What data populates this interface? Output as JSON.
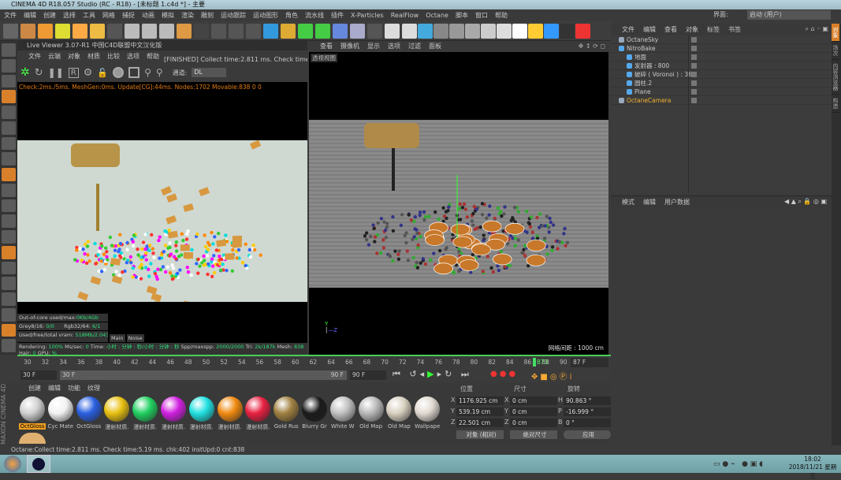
{
  "window": {
    "title": "CINEMA 4D R18.057 Studio (RC - R18) - [未标题 1.c4d *] - 主要"
  },
  "menu": [
    "文件",
    "编辑",
    "创建",
    "选择",
    "工具",
    "网格",
    "捕捉",
    "动画",
    "模拟",
    "渲染",
    "雕刻",
    "运动跟踪",
    "运动图形",
    "角色",
    "流水线",
    "插件",
    "X-Particles",
    "RealFlow",
    "Octane",
    "脚本",
    "窗口",
    "帮助"
  ],
  "layout": {
    "label": "界面:",
    "value": "启动 (用户)"
  },
  "live_viewer": {
    "title": "Live Viewer 3.07-R1 中国C4D联盟中文汉化版",
    "menu": [
      "文件",
      "云端",
      "对象",
      "材质",
      "比较",
      "选项",
      "帮助"
    ],
    "message": "[FINISHED] Collect time:2.811 ms.  Check time:5.19",
    "channel_label": "通道:",
    "channel_value": "DL",
    "check_line": "Check:2ms./5ms. MeshGen:0ms. Update[CG]:44ms. Nodes:1702 Movable:838  0 0",
    "stats": {
      "outofcore_label": "Out-of-core used/max:",
      "outofcore": "0Kb/4Gb",
      "grey_label": "Grey8/16:",
      "grey": "0/0",
      "rgb_label": "Rgb32/64:",
      "rgb": "6/1",
      "vram_label": "Used/free/total vram:",
      "vram": "518Mb/2.043Gb/3Gb",
      "main": "Main",
      "noise": "Noise",
      "rendering_label": "Rendering:",
      "rendering": "100%",
      "mss_label": "Ms/sec:",
      "mss": "0",
      "time_label": "Time:",
      "time": "小时 : 分钟 : 秒/小时 : 分钟 : 秒",
      "spp_label": "Spp/maxspp:",
      "spp": "2000/2000",
      "tri_label": "Tri:",
      "tri": "2k/187k",
      "mesh_label": "Mesh:",
      "mesh": "838",
      "hair_label": "Hair:",
      "hair": "0",
      "gpu_label": "GPU:",
      "gpu": "%"
    },
    "progress": 1.0
  },
  "viewport": {
    "menu": [
      "查看",
      "摄像机",
      "显示",
      "选项",
      "过滤",
      "面板"
    ],
    "view_name": "透视视图",
    "grid_spacing": "网格间距 : 1000 cm"
  },
  "object_manager": {
    "menu": [
      "文件",
      "编辑",
      "查看",
      "对象",
      "标签",
      "书签"
    ],
    "objects": [
      {
        "name": "OctaneSky",
        "indent": 0,
        "color": "#c8c8c8"
      },
      {
        "name": "NitroBake",
        "indent": 0,
        "color": "#c8c8c8"
      },
      {
        "name": "地面",
        "indent": 1,
        "color": "#c8c8c8"
      },
      {
        "name": "发射器 : 800",
        "indent": 1,
        "color": "#c8c8c8"
      },
      {
        "name": "破碎 ( Voronoi ) : 36",
        "indent": 1,
        "color": "#c8c8c8"
      },
      {
        "name": "圆柱.2",
        "indent": 1,
        "color": "#c8c8c8"
      },
      {
        "name": "Plane",
        "indent": 1,
        "color": "#c8c8c8"
      },
      {
        "name": "OctaneCamera",
        "indent": 0,
        "color": "#f0b030"
      }
    ]
  },
  "attributes": {
    "menu": [
      "模式",
      "编辑",
      "用户数据"
    ]
  },
  "right_tabs": [
    "对象",
    "场次",
    "内容浏览器",
    "构造"
  ],
  "timeline": {
    "ticks": [
      "30",
      "32",
      "34",
      "36",
      "38",
      "40",
      "42",
      "44",
      "46",
      "48",
      "50",
      "52",
      "54",
      "56",
      "58",
      "60",
      "62",
      "64",
      "66",
      "68",
      "70",
      "72",
      "74",
      "76",
      "78",
      "80",
      "82",
      "84",
      "86",
      "88",
      "90"
    ],
    "current_label": "873",
    "current_frame": "87 F",
    "min": 30,
    "max": 90,
    "current": 87
  },
  "controls": {
    "start": "30 F",
    "range_start": "30 F",
    "range_end": "90 F",
    "end": "90 F"
  },
  "materials": {
    "menu": [
      "创建",
      "编辑",
      "功能",
      "纹理"
    ],
    "items": [
      {
        "name": "OctGloss",
        "color": "#d0d0d0",
        "selected": true
      },
      {
        "name": "Cyc Mate",
        "color": "#f2f2f2"
      },
      {
        "name": "OctGloss",
        "color": "#2a5fe0"
      },
      {
        "name": "漫射材质.",
        "color": "#e8c010"
      },
      {
        "name": "漫射材质.",
        "color": "#20d060"
      },
      {
        "name": "漫射材质.",
        "color": "#d020e0"
      },
      {
        "name": "漫射材质.",
        "color": "#20e0e0"
      },
      {
        "name": "漫射材质.",
        "color": "#f08a10"
      },
      {
        "name": "漫射材质.",
        "color": "#e82040"
      },
      {
        "name": "Gold Rus",
        "color": "#a08040"
      },
      {
        "name": "Blurry Gr",
        "color": "#1a1a1a"
      },
      {
        "name": "White W",
        "color": "#c0c0c0"
      },
      {
        "name": "Old Map",
        "color": "#b8b8b8"
      },
      {
        "name": "Old Map",
        "color": "#d8d0c0"
      },
      {
        "name": "Wallpape",
        "color": "#e0d8d0"
      }
    ],
    "logo": "MAXON CINEMA 4D"
  },
  "coordinates": {
    "headers": [
      "位置",
      "尺寸",
      "旋转"
    ],
    "position": [
      {
        "axis": "X",
        "value": "1176.925 cm"
      },
      {
        "axis": "Y",
        "value": "539.19 cm"
      },
      {
        "axis": "Z",
        "value": "22.501 cm"
      }
    ],
    "size": [
      {
        "axis": "X",
        "value": "0 cm"
      },
      {
        "axis": "Y",
        "value": "0 cm"
      },
      {
        "axis": "Z",
        "value": "0 cm"
      }
    ],
    "rotation": [
      {
        "axis": "H",
        "value": "90.863 °"
      },
      {
        "axis": "P",
        "value": "-16.999 °"
      },
      {
        "axis": "B",
        "value": "0 °"
      }
    ],
    "mode": "对象 (相对)",
    "size_mode": "绝对尺寸",
    "apply": "应用"
  },
  "status": "Octane:Collect time:2.811 ms.  Check time:5.19 ms.  chk:402  instUpd:0  cnt:838",
  "taskbar": {
    "time": "18:02",
    "date": "2018/11/21 星期三"
  }
}
